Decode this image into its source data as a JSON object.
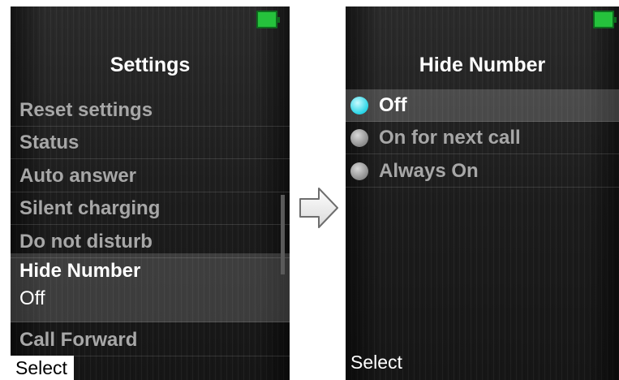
{
  "left_screen": {
    "title": "Settings",
    "menu": [
      {
        "label": "Reset settings"
      },
      {
        "label": "Status"
      },
      {
        "label": "Auto answer"
      },
      {
        "label": "Silent charging"
      },
      {
        "label": "Do not disturb"
      },
      {
        "label": "Hide Number",
        "value": "Off"
      },
      {
        "label": "Call Forward"
      }
    ],
    "softkey": "Select"
  },
  "right_screen": {
    "title": "Hide Number",
    "options": [
      {
        "label": "Off",
        "selected": true
      },
      {
        "label": "On for next call",
        "selected": false
      },
      {
        "label": "Always On",
        "selected": false
      }
    ],
    "softkey": "Select"
  },
  "colors": {
    "battery": "#25c23c",
    "radio_selected": "#27d4e6",
    "text_dim": "#a7a7a7",
    "text_active": "#ffffff"
  },
  "icons": {
    "battery": "battery-icon",
    "transition": "arrow-right-icon",
    "radio": "radio-button-icon"
  }
}
